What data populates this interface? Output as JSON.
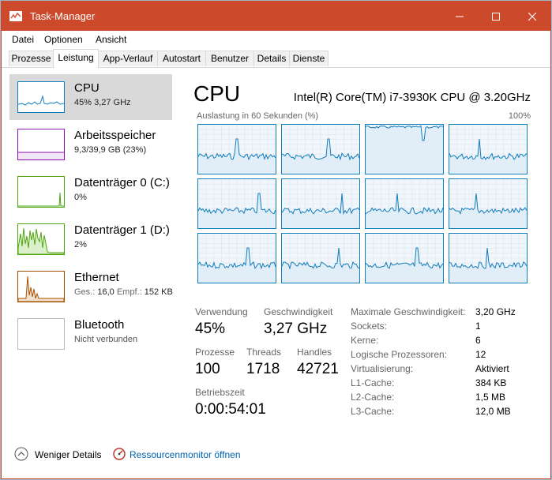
{
  "window": {
    "title": "Task-Manager"
  },
  "menu": [
    "Datei",
    "Optionen",
    "Ansicht"
  ],
  "tabs": [
    "Prozesse",
    "Leistung",
    "App-Verlauf",
    "Autostart",
    "Benutzer",
    "Details",
    "Dienste"
  ],
  "active_tab": "Leistung",
  "sidebar": [
    {
      "name": "CPU",
      "sub": "45% 3,27 GHz",
      "color": "#117dbb",
      "selected": true
    },
    {
      "name": "Arbeitsspeicher",
      "sub": "9,3/39,9 GB (23%)",
      "color": "#8b12ae",
      "selected": false
    },
    {
      "name": "Datenträger 0 (C:)",
      "sub": "0%",
      "color": "#4da60c",
      "selected": false
    },
    {
      "name": "Datenträger 1 (D:)",
      "sub": "2%",
      "color": "#4da60c",
      "selected": false
    },
    {
      "name": "Ethernet",
      "sub_label_1": "Ges.:",
      "sub_value_1": "16,0",
      "sub_label_2": "Empf.:",
      "sub_value_2": "152 KB",
      "color": "#a74f01",
      "selected": false
    },
    {
      "name": "Bluetooth",
      "sub": "Nicht verbunden",
      "color": "#999999",
      "selected": false
    }
  ],
  "main": {
    "title": "CPU",
    "model": "Intel(R) Core(TM) i7-3930K CPU @ 3.20GHz",
    "util_label": "Auslastung in 60 Sekunden (%)",
    "util_max": "100%",
    "core_count_graphs": 12,
    "graph_color": "#117dbb",
    "stats": {
      "usage_label": "Verwendung",
      "usage_value": "45%",
      "speed_label": "Geschwindigkeit",
      "speed_value": "3,27 GHz",
      "processes_label": "Prozesse",
      "processes_value": "100",
      "threads_label": "Threads",
      "threads_value": "1718",
      "handles_label": "Handles",
      "handles_value": "42721",
      "uptime_label": "Betriebszeit",
      "uptime_value": "0:00:54:01"
    },
    "details": [
      {
        "label": "Maximale Geschwindigkeit:",
        "value": "3,20 GHz"
      },
      {
        "label": "Sockets:",
        "value": "1"
      },
      {
        "label": "Kerne:",
        "value": "6"
      },
      {
        "label": "Logische Prozessoren:",
        "value": "12"
      },
      {
        "label": "Virtualisierung:",
        "value": "Aktiviert"
      },
      {
        "label": "L1-Cache:",
        "value": "384 KB"
      },
      {
        "label": "L2-Cache:",
        "value": "1,5 MB"
      },
      {
        "label": "L3-Cache:",
        "value": "12,0 MB"
      }
    ]
  },
  "footer": {
    "less_details": "Weniger Details",
    "resource_monitor": "Ressourcenmonitor öffnen"
  }
}
